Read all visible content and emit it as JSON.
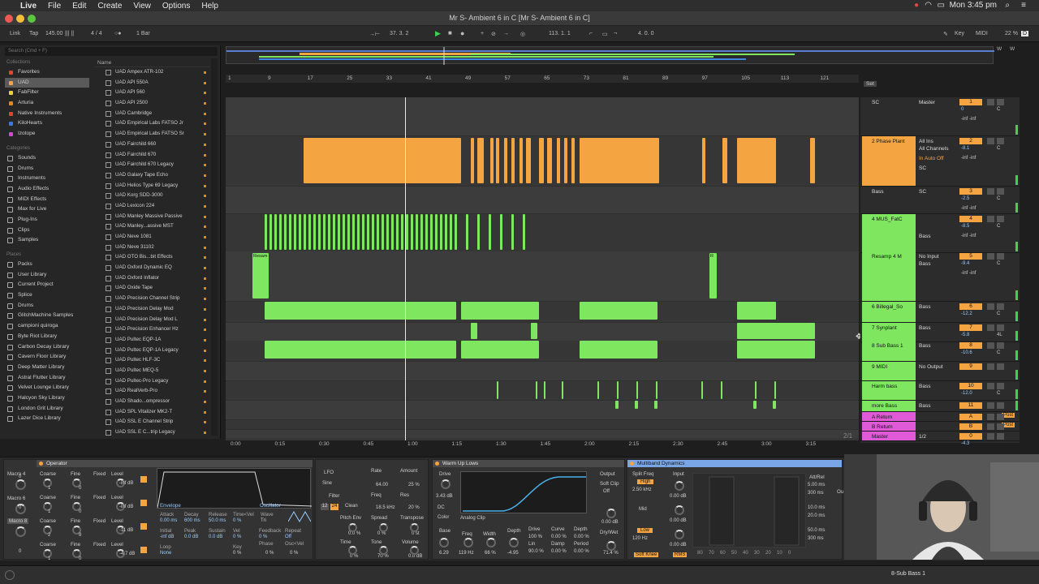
{
  "menubar": {
    "apple_glyph": "",
    "app_name": "Live",
    "menus": [
      "File",
      "Edit",
      "Create",
      "View",
      "Options",
      "Help"
    ],
    "clock": "Mon 3:45 pm"
  },
  "window": {
    "title": "Mr S- Ambient 6 in C  [Mr S- Ambient 6 in C]"
  },
  "transport": {
    "link": "Link",
    "tap": "Tap",
    "tempo": "145.00",
    "signature": "4 / 4",
    "quantize": "1 Bar",
    "position": "37.  3.  2",
    "loop_start": "113.  1.  1",
    "loop_length": "4.  0.  0",
    "key_label": "Key",
    "midi_label": "MIDI",
    "cpu": "22 %",
    "cpu_d": "D"
  },
  "browser": {
    "search_placeholder": "Search (Cmd + F)",
    "collections_header": "Collections",
    "collections": [
      {
        "label": "Favorites",
        "color": "#e0452e"
      },
      {
        "label": "UAD",
        "color": "#f5a442",
        "selected": true
      },
      {
        "label": "FabFilter",
        "color": "#e8d43a"
      },
      {
        "label": "Arturia",
        "color": "#e08a1e"
      },
      {
        "label": "Native Instruments",
        "color": "#e0452e"
      },
      {
        "label": "KiloHearts",
        "color": "#3c78e0"
      },
      {
        "label": "Izotope",
        "color": "#d04ad0"
      }
    ],
    "categories_header": "Categories",
    "categories": [
      "Sounds",
      "Drums",
      "Instruments",
      "Audio Effects",
      "MIDI Effects",
      "Max for Live",
      "Plug-Ins",
      "Clips",
      "Samples"
    ],
    "places_header": "Places",
    "places": [
      "Packs",
      "User Library",
      "Current Project",
      "Splice",
      "Drums",
      "GlitchMachine Samples",
      "campioni quiroga",
      "Byte Riot Library",
      "Carbon Decay Library",
      "Cavern Floor Library",
      "Deep Matter Library",
      "Astral Flutter Library",
      "Velvet Lounge Library",
      "Halcyon Sky Library",
      "London Grit Library",
      "Lazer Dice Library"
    ],
    "list_header": "Name",
    "items": [
      "UAD Ampex ATR-102",
      "UAD API 550A",
      "UAD API 560",
      "UAD API 2500",
      "UAD Cambridge",
      "UAD Empirical Labs FATSO Jr",
      "UAD Empirical Labs FATSO Sr",
      "UAD Fairchild 660",
      "UAD Fairchild 670",
      "UAD Fairchild 670 Legacy",
      "UAD Galaxy Tape Echo",
      "UAD Helios Type 69 Legacy",
      "UAD Korg SDD-3000",
      "UAD Lexicon 224",
      "UAD Manley Massive Passive",
      "UAD Manley...assive MST",
      "UAD Neve 1081",
      "UAD Neve 31102",
      "UAD OTO Bis...bit Effects",
      "UAD Oxford Dynamic EQ",
      "UAD Oxford Inflator",
      "UAD Oxide Tape",
      "UAD Precision Channel Strip",
      "UAD Precision Delay Mod",
      "UAD Precision Delay Mod L",
      "UAD Precision Enhancer Hz",
      "UAD Pultec EQP-1A",
      "UAD Pultec EQP-1A Legacy",
      "UAD Pultec HLF-3C",
      "UAD Pultec MEQ-5",
      "UAD Pultec-Pro Legacy",
      "UAD RealVerb-Pro",
      "UAD Shado...ompressor",
      "UAD SPL Vitalizer MK2-T",
      "UAD SSL E Channel Strip",
      "UAD SSL E C...trip Legacy"
    ]
  },
  "arrangement": {
    "bar_numbers": [
      "1",
      "9",
      "17",
      "25",
      "33",
      "41",
      "49",
      "57",
      "65",
      "73",
      "81",
      "89",
      "97",
      "105",
      "113",
      "121"
    ],
    "time_labels": [
      "0:00",
      "0:15",
      "0:30",
      "0:45",
      "1:00",
      "1:15",
      "1:30",
      "1:45",
      "2:00",
      "2:15",
      "2:30",
      "2:45",
      "3:00",
      "3:15"
    ],
    "zoom_label": "2/1",
    "clip_names": {
      "resample1": "Resam",
      "resample2": "R"
    },
    "set_label": "Set"
  },
  "tracks": [
    {
      "name": "SC",
      "color": "#2c2c2c",
      "text_color": "#ddd",
      "io": "Master",
      "num": "1",
      "vol": "0",
      "pan": "C",
      "inf": "-inf   -inf"
    },
    {
      "name": "2 Phase Plant",
      "color": "#f5a442",
      "io": "All Ins",
      "io2": "All Channels",
      "io3": "SC",
      "mon": "In  Auto  Off",
      "num": "2",
      "vol": "-8.1",
      "pan": "C",
      "inf": "-inf   -inf"
    },
    {
      "name": "Bass",
      "color": "#2c2c2c",
      "text_color": "#ddd",
      "io": "SC",
      "num": "3",
      "vol": "-2.5",
      "pan": "C",
      "inf": "-inf   -inf"
    },
    {
      "name": "4 MUS_FatC",
      "color": "#7ee65f",
      "io2": "Bass",
      "num": "4",
      "vol": "-8.5",
      "pan": "C",
      "inf": "-inf   -inf"
    },
    {
      "name": "Resamp 4 M",
      "color": "#7ee65f",
      "io": "No Input",
      "io2": "Bass",
      "num": "5",
      "vol": "-9.4",
      "pan": "C",
      "inf": "-inf   -inf"
    },
    {
      "name": "6 Billegal_So",
      "color": "#7ee65f",
      "io": "Bass",
      "num": "6",
      "vol": "-12.2",
      "pan": "C"
    },
    {
      "name": "7 Synplant",
      "color": "#7ee65f",
      "io": "Bass",
      "num": "7",
      "vol": "-5.8",
      "pan": "4L"
    },
    {
      "name": "8 Sub Bass 1",
      "color": "#7ee65f",
      "io": "Bass",
      "num": "8",
      "vol": "-10.6",
      "pan": "C"
    },
    {
      "name": "9 MIDI",
      "color": "#7ee65f",
      "io": "No Output",
      "num": "9"
    },
    {
      "name": "Harm bass",
      "color": "#7ee65f",
      "io": "Bass",
      "num": "10",
      "vol": "-12.0",
      "pan": "C"
    },
    {
      "name": "more Bass",
      "color": "#7ee65f",
      "io": "Bass",
      "num": "11"
    },
    {
      "name": "A Return",
      "color": "#e05ad8",
      "num": "A",
      "send": "Post"
    },
    {
      "name": "B Return",
      "color": "#e05ad8",
      "num": "B",
      "send": "Post"
    },
    {
      "name": "Master",
      "color": "#e05ad8",
      "io": "1/2",
      "num": "0",
      "vol": "-4.3"
    }
  ],
  "devices": {
    "operator": {
      "title": "Operator",
      "macros": [
        "Macro 4",
        "Macro 6",
        "Macro 8"
      ],
      "labels": [
        "Coarse",
        "Fine",
        "Fixed",
        "Level"
      ],
      "rows": [
        {
          "coarse": "1",
          "fine": "0",
          "level": "-inf dB"
        },
        {
          "coarse": "1",
          "fine": "0",
          "level": "-inf dB"
        },
        {
          "coarse": "2",
          "fine": "8",
          "level": "-11 dB"
        },
        {
          "coarse": "1",
          "fine": "0",
          "level": "-4.7 dB"
        }
      ],
      "macro_vals": [
        "0",
        "0",
        "0"
      ],
      "env_tab": "Envelope",
      "osc_tab": "Oscillator",
      "env_labels": [
        "Attack",
        "Decay",
        "Release",
        "Time<Vel",
        "Wave"
      ],
      "env_vals": [
        "0.00 ms",
        "600 ms",
        "50.0 ms",
        "0 %"
      ],
      "env_labels2": [
        "Initial",
        "Peak",
        "Sustain",
        "Vel",
        "Feedback",
        "Repeat"
      ],
      "env_vals2": [
        "-inf dB",
        "0.0 dB",
        "0.0 dB",
        "0 %",
        "0 %",
        "Off"
      ],
      "loop_label": "Loop",
      "loop_val": "None",
      "key_label": "Key",
      "key_val": "0 %",
      "phase_label": "Phase",
      "phase_val": "0 %",
      "oscvel_label": "Osc<Vel",
      "oscvel_val": "0 %",
      "wave_val": "Tri"
    },
    "lfo": {
      "lfo": "LFO",
      "rate": "Rate",
      "rate_val": "64.00",
      "amount": "Amount",
      "amount_val": "25 %",
      "wave": "Sine",
      "filter": "Filter",
      "freq": "Freq",
      "freq_val": "18.5 kHz",
      "res": "Res",
      "res_val": "20 %",
      "filter_type": "Clean",
      "slopes": [
        "12",
        "24"
      ],
      "pitch_env": "Pitch Env",
      "pitch_val": "0.0 %",
      "spread": "Spread",
      "spread_val": "0 %",
      "transpose": "Transpose",
      "transpose_val": "0 st",
      "time": "Time",
      "time_val": "0 %",
      "tone": "Tone",
      "tone_val": "70 %",
      "volume": "Volume",
      "volume_val": "0.0 dB"
    },
    "saturator": {
      "title": "Warm Up Lows",
      "drive": "Drive",
      "drive_val": "3.43 dB",
      "dc": "DC",
      "color": "Color",
      "mode": "Analog Clip",
      "output": "Output",
      "soft_clip": "Soft Clip",
      "soft_clip_val": "Off",
      "output_val": "0.00 dB",
      "drywet": "Dry/Wet",
      "drywet_val": "71.4 %",
      "base": "Base",
      "base_val": "6.29",
      "freq": "Freq",
      "freq_val": "119 Hz",
      "width": "Width",
      "width_val": "66 %",
      "depth": "Depth",
      "depth_val": "-4.95",
      "drive2": "Drive",
      "drive2_val": "100 %",
      "curve": "Curve",
      "curve_val": "0.00 %",
      "depth2": "Depth",
      "depth2_val": "0.00 %",
      "lin": "Lin",
      "lin_val": "90.0 %",
      "damp": "Damp",
      "damp_val": "0.00 %",
      "period": "Period",
      "period_val": "0.00 %"
    },
    "multiband": {
      "title": "Multiband Dynamics",
      "split_freq": "Split Freq",
      "input": "Input",
      "high": "High",
      "high_freq": "2.50 kHz",
      "mid": "Mid",
      "low": "Low",
      "low_freq": "120 Hz",
      "input_vals": [
        "0.00 dB",
        "0.00 dB",
        "0.00 dB"
      ],
      "soft_knee": "Soft Knee",
      "rms": "RMS",
      "att_rel": "Att/Rel",
      "times": [
        "5.00 ms",
        "300 ms",
        "10.0 ms",
        "20.0 ms",
        "50.0 ms",
        "300 ms"
      ],
      "scale": [
        "80",
        "70",
        "60",
        "50",
        "40",
        "30",
        "20",
        "10",
        "0"
      ],
      "out": "Ou"
    }
  },
  "statusbar": {
    "track": "8-Sub Bass 1"
  },
  "colors": {
    "orange": "#f5a442",
    "green": "#7ee65f",
    "pink": "#e05ad8"
  }
}
